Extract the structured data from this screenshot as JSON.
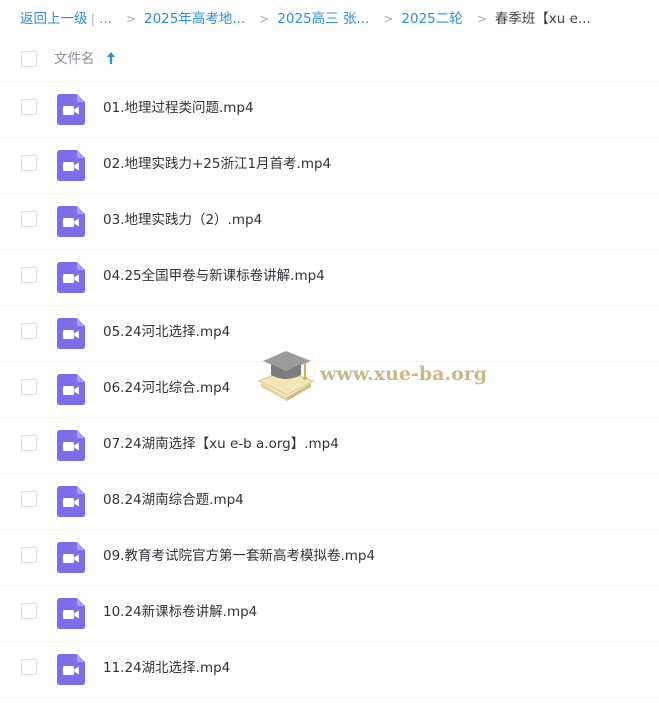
{
  "breadcrumb": {
    "back": "返回上一级",
    "separator": "|",
    "ellipsis": "...",
    "arrow": ">",
    "items": [
      "2025年高考地...",
      "2025高三 张...",
      "2025二轮"
    ],
    "current": "春季班【xu e..."
  },
  "header": {
    "name_label": "文件名",
    "sort_icon": "arrow-up-icon"
  },
  "files": [
    {
      "name": "01.地理过程类问题.mp4",
      "icon": "video-file-icon"
    },
    {
      "name": "02.地理实践力+25浙江1月首考.mp4",
      "icon": "video-file-icon"
    },
    {
      "name": "03.地理实践力（2）.mp4",
      "icon": "video-file-icon"
    },
    {
      "name": "04.25全国甲卷与新课标卷讲解.mp4",
      "icon": "video-file-icon"
    },
    {
      "name": "05.24河北选择.mp4",
      "icon": "video-file-icon"
    },
    {
      "name": "06.24河北综合.mp4",
      "icon": "video-file-icon"
    },
    {
      "name": "07.24湖南选择【xu e-b a.org】.mp4",
      "icon": "video-file-icon"
    },
    {
      "name": "08.24湖南综合题.mp4",
      "icon": "video-file-icon"
    },
    {
      "name": "09.教育考试院官方第一套新高考模拟卷.mp4",
      "icon": "video-file-icon"
    },
    {
      "name": "10.24新课标卷讲解.mp4",
      "icon": "video-file-icon"
    },
    {
      "name": "11.24湖北选择.mp4",
      "icon": "video-file-icon"
    }
  ],
  "watermark": {
    "text": "www.xue-ba.org",
    "icon": "graduation-cap-icon"
  },
  "colors": {
    "link": "#2b8fd6",
    "video_icon": "#7b6ee8",
    "text": "#2f3338"
  }
}
